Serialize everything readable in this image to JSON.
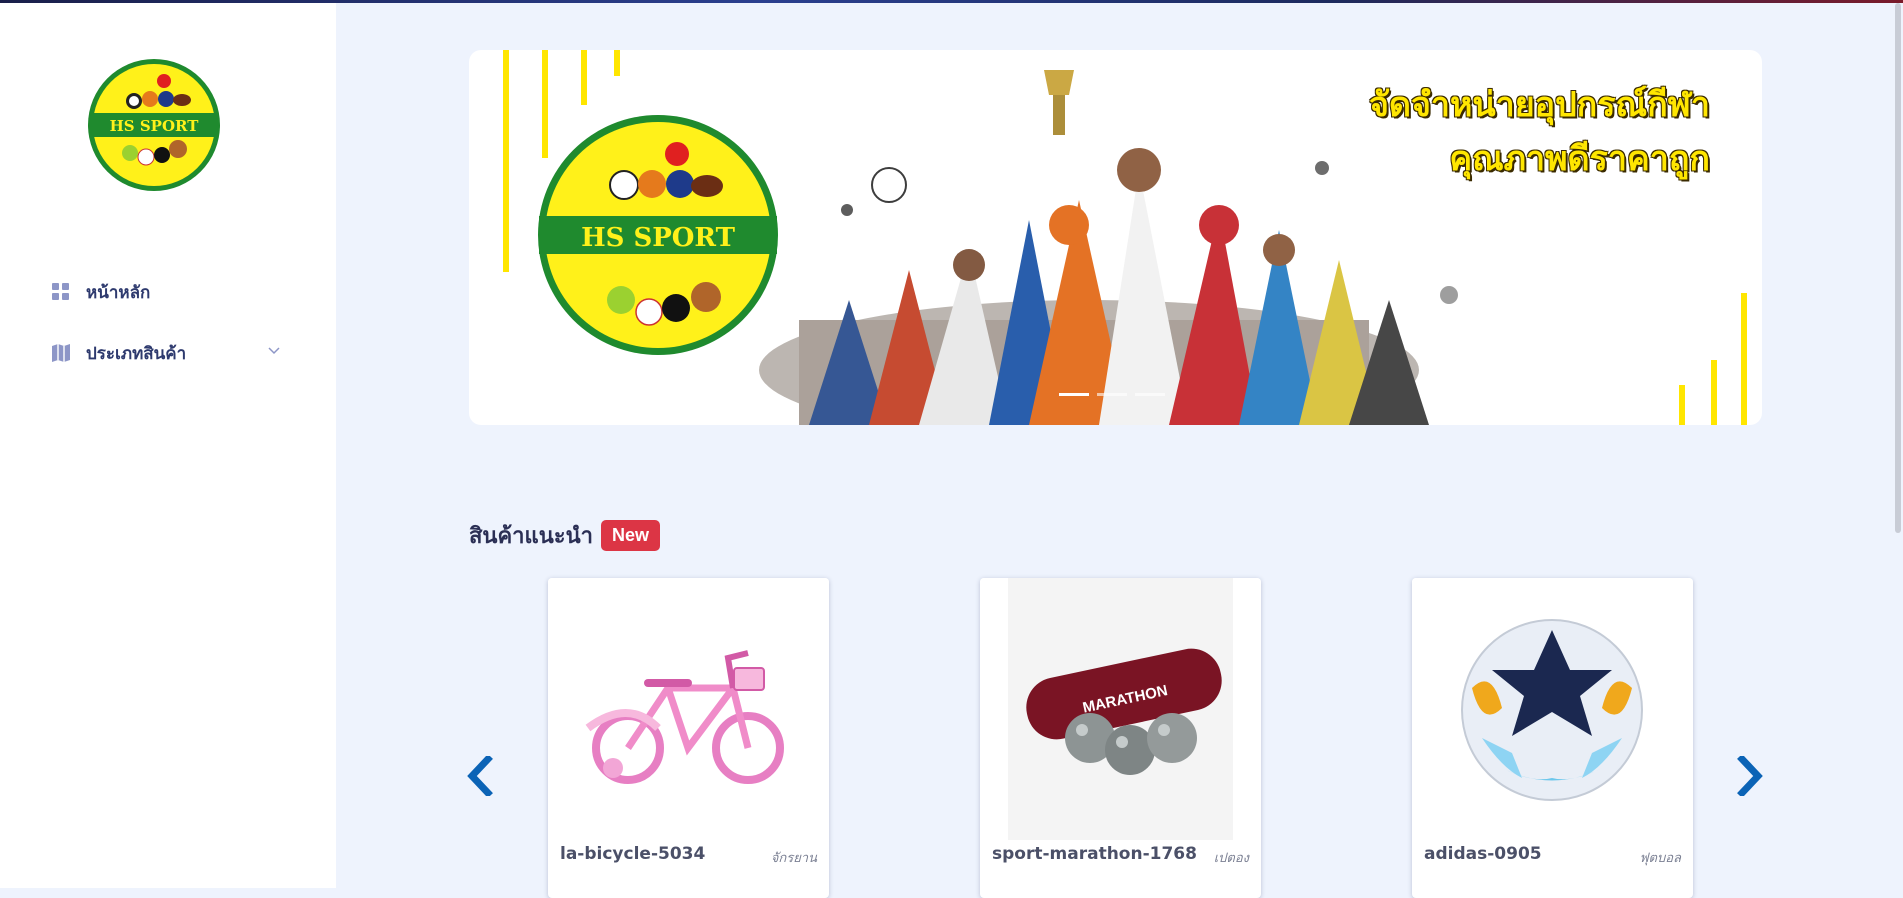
{
  "sidebar": {
    "logo_text": "HS SPORT",
    "items": [
      {
        "label": "หน้าหลัก",
        "icon": "grid-icon"
      },
      {
        "label": "ประเภทสินค้า",
        "icon": "map-icon"
      }
    ]
  },
  "banner": {
    "logo_text": "HS SPORT",
    "title_line1": "จัดจำหน่ายอุปกรณ์กีฬา",
    "title_line2": "คุณภาพดีราคาถูก"
  },
  "featured": {
    "title": "สินค้าแนะนำ",
    "badge": "New",
    "products": [
      {
        "name": "la-bicycle-5034",
        "category": "จักรยาน",
        "image": "pink-bicycle"
      },
      {
        "name": "sport-marathon-1768",
        "category": "เปตอง",
        "image": "petanque-set"
      },
      {
        "name": "adidas-0905",
        "category": "ฟุตบอล",
        "image": "soccer-ball"
      }
    ]
  },
  "colors": {
    "background": "#eef3fd",
    "nav_text": "#2e3a6e",
    "badge": "#dc3545",
    "arrow": "#0b63b6",
    "logo_yellow": "#fff11a",
    "logo_green": "#1f8a2e"
  }
}
